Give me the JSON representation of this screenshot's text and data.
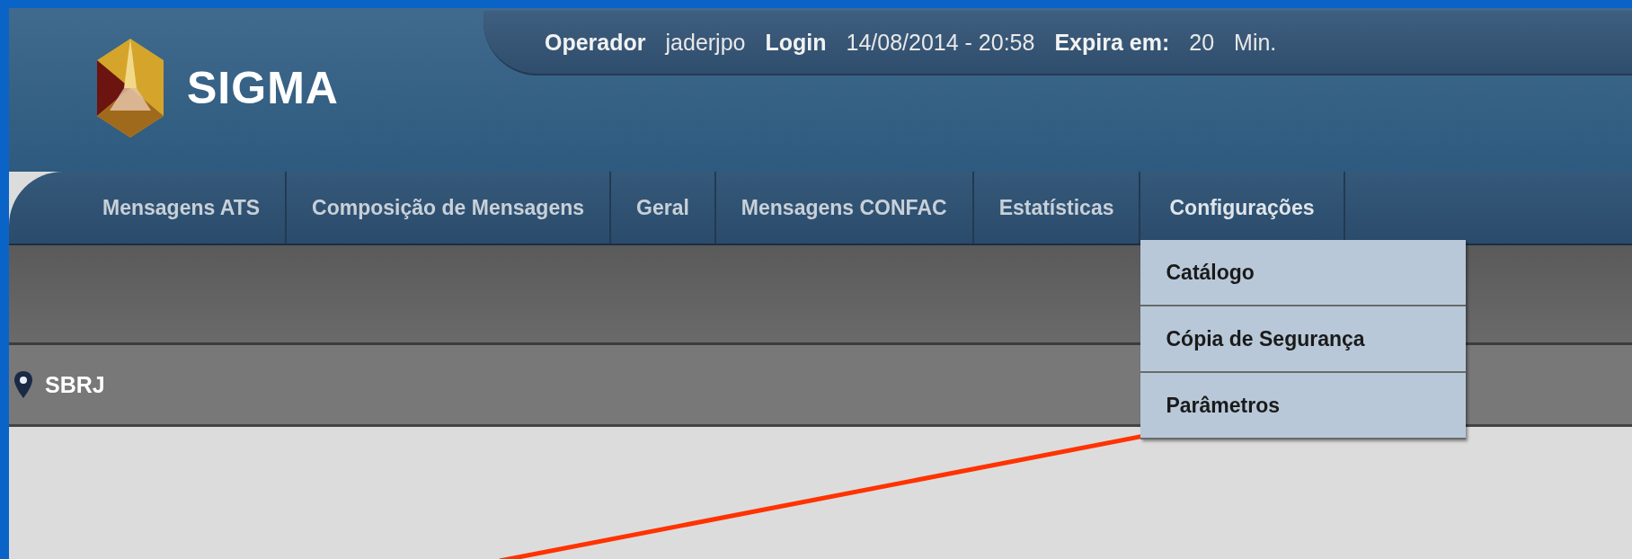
{
  "header": {
    "logo_text": "SIGMA",
    "session": [
      {
        "kind": "label",
        "text": "Operador"
      },
      {
        "kind": "value",
        "text": "jaderjpo"
      },
      {
        "kind": "label",
        "text": "Login"
      },
      {
        "kind": "value",
        "text": "14/08/2014 - 20:58"
      },
      {
        "kind": "label",
        "text": "Expira em:"
      },
      {
        "kind": "value",
        "text": "20"
      },
      {
        "kind": "value",
        "text": "Min."
      }
    ]
  },
  "nav": {
    "items": [
      {
        "label": "Mensagens ATS",
        "expanded": false
      },
      {
        "label": "Composição de Mensagens",
        "expanded": false
      },
      {
        "label": "Geral",
        "expanded": false
      },
      {
        "label": "Mensagens CONFAC",
        "expanded": false
      },
      {
        "label": "Estatísticas",
        "expanded": false
      },
      {
        "label": "Configurações",
        "expanded": true,
        "menu": [
          "Catálogo",
          "Cópia de Segurança",
          "Parâmetros"
        ]
      }
    ]
  },
  "location": {
    "text": "SBRJ"
  },
  "annotation": {
    "kind": "line"
  }
}
